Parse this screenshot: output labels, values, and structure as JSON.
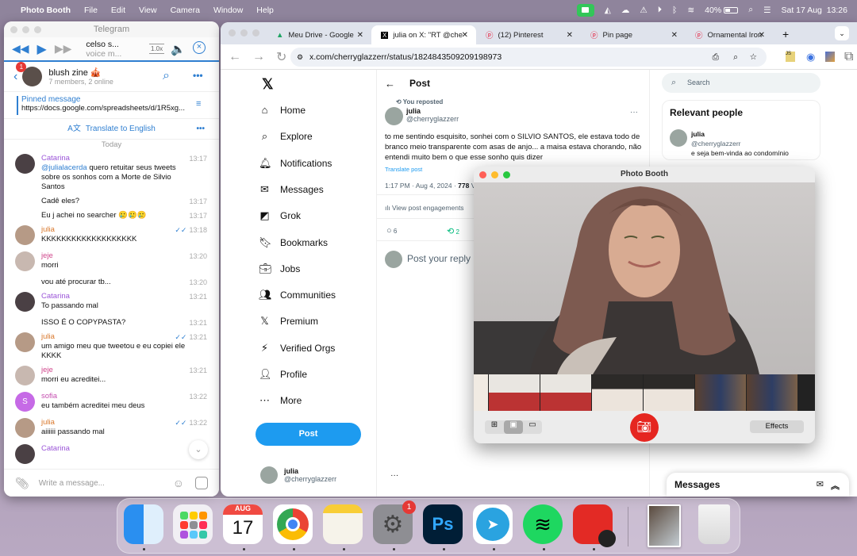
{
  "menubar": {
    "app_name": "Photo Booth",
    "items": [
      "File",
      "Edit",
      "View",
      "Camera",
      "Window",
      "Help"
    ],
    "battery": "40%",
    "datetime": "Sat 17 Aug  13:26"
  },
  "telegram": {
    "window_title": "Telegram",
    "player": {
      "title": "celso s...",
      "subtitle": "voice m...",
      "speed": "1.0x"
    },
    "chat": {
      "name": "blush zine 🎪",
      "subtitle": "7 members, 2 online",
      "unread_badge": "1"
    },
    "pinned": {
      "label": "Pinned message",
      "text": "https://docs.google.com/spreadsheets/d/1R5xg..."
    },
    "translate_label": "Translate to English",
    "date_separator": "Today",
    "messages": [
      {
        "sender": "Catarina",
        "color": "#9b55d8",
        "mention": "@julialacerda",
        "text": " quero retuitar seus tweets sobre os sonhos com a Morte de Silvio Santos",
        "time": "13:17",
        "avatar": "#4a4044"
      },
      {
        "sender": "",
        "text": "Cadê eles?",
        "time": "13:17"
      },
      {
        "sender": "",
        "text": "Eu j achei no searcher 🥲🥲🥲",
        "time": "13:17"
      },
      {
        "sender": "julia",
        "color": "#d9782c",
        "text": "KKKKKKKKKKKKKKKKKKK",
        "time": "13:18",
        "read": true,
        "avatar": "#b69a86"
      },
      {
        "sender": "jeje",
        "color": "#d0468c",
        "text": "morri",
        "time": "13:20",
        "avatar": "#c8b8b0"
      },
      {
        "sender": "",
        "text": "vou até procurar tb...",
        "time": "13:20"
      },
      {
        "sender": "Catarina",
        "color": "#9b55d8",
        "text": "To passando mal",
        "time": "13:21",
        "avatar": "#4a4044"
      },
      {
        "sender": "",
        "text": "ISSO É O COPYPASTA?",
        "time": "13:21"
      },
      {
        "sender": "julia",
        "color": "#d9782c",
        "text": "um amigo meu que tweetou  e eu copiei ele KKKK",
        "time": "13:21",
        "read": true,
        "avatar": "#b69a86"
      },
      {
        "sender": "jeje",
        "color": "#d0468c",
        "text": "morri eu acreditei...",
        "time": "13:21",
        "avatar": "#c8b8b0"
      },
      {
        "sender": "sofia",
        "color": "#c54fb0",
        "text": "eu também acreditei meu deus",
        "time": "13:22",
        "avatar_letter": "S",
        "avatar": "#c66ae6"
      },
      {
        "sender": "julia",
        "color": "#d9782c",
        "text": "aiiiiii passando mal",
        "time": "13:22",
        "read": true,
        "avatar": "#b69a86"
      },
      {
        "sender": "Catarina",
        "color": "#9b55d8",
        "text": "",
        "time": "13:22",
        "avatar": "#4a4044"
      }
    ],
    "input_placeholder": "Write a message..."
  },
  "chrome": {
    "tabs": [
      {
        "title": "Meu Drive - Google",
        "icon": "google-drive-icon"
      },
      {
        "title": "julia on X: \"RT @che",
        "icon": "x-logo-icon",
        "active": true
      },
      {
        "title": "(12) Pinterest",
        "icon": "pinterest-icon"
      },
      {
        "title": "Pin page",
        "icon": "pinterest-icon"
      },
      {
        "title": "Ornamental Iron Rai",
        "icon": "pinterest-icon"
      }
    ],
    "url": "x.com/cherryglazzerr/status/1824843509209198973"
  },
  "x": {
    "nav": [
      "Home",
      "Explore",
      "Notifications",
      "Messages",
      "Grok",
      "Bookmarks",
      "Jobs",
      "Communities",
      "Premium",
      "Verified Orgs",
      "Profile",
      "More"
    ],
    "post_button": "Post",
    "account": {
      "name": "julia",
      "handle": "@cherryglazzerr"
    },
    "header_title": "Post",
    "reposted_label": "You reposted",
    "tweet": {
      "author": "julia",
      "handle": "@cherryglazzerr",
      "text": "to me sentindo esquisito, sonhei com o SILVIO SANTOS, ele estava todo de branco meio transparente com asas de anjo... a maisa estava chorando, não entendi muito bem o que esse sonho quis dizer",
      "translate": "Translate post",
      "timestamp": "1:17 PM · Aug 4, 2024 · ",
      "views": "778",
      "views_label": " Vi",
      "engagements": "View post engagements",
      "replies": "6",
      "reposts": "2"
    },
    "reply_placeholder": "Post your reply",
    "search_placeholder": "Search",
    "relevant": {
      "title": "Relevant people",
      "name": "julia",
      "handle": "@cherryglazzerr",
      "bio": "e seja bem-vinda ao condomínio"
    },
    "messages_drawer": "Messages"
  },
  "photobooth": {
    "title": "Photo Booth",
    "effects_label": "Effects",
    "thumbnail_count": 7
  },
  "dock": {
    "apps": [
      "Finder",
      "Launchpad",
      "Calendar",
      "Google Chrome",
      "Notes",
      "System Settings",
      "Photoshop",
      "Telegram",
      "Spotify",
      "Photo Booth",
      "Downloads",
      "Trash"
    ],
    "calendar_month": "AUG",
    "calendar_day": "17",
    "settings_badge": "1"
  }
}
